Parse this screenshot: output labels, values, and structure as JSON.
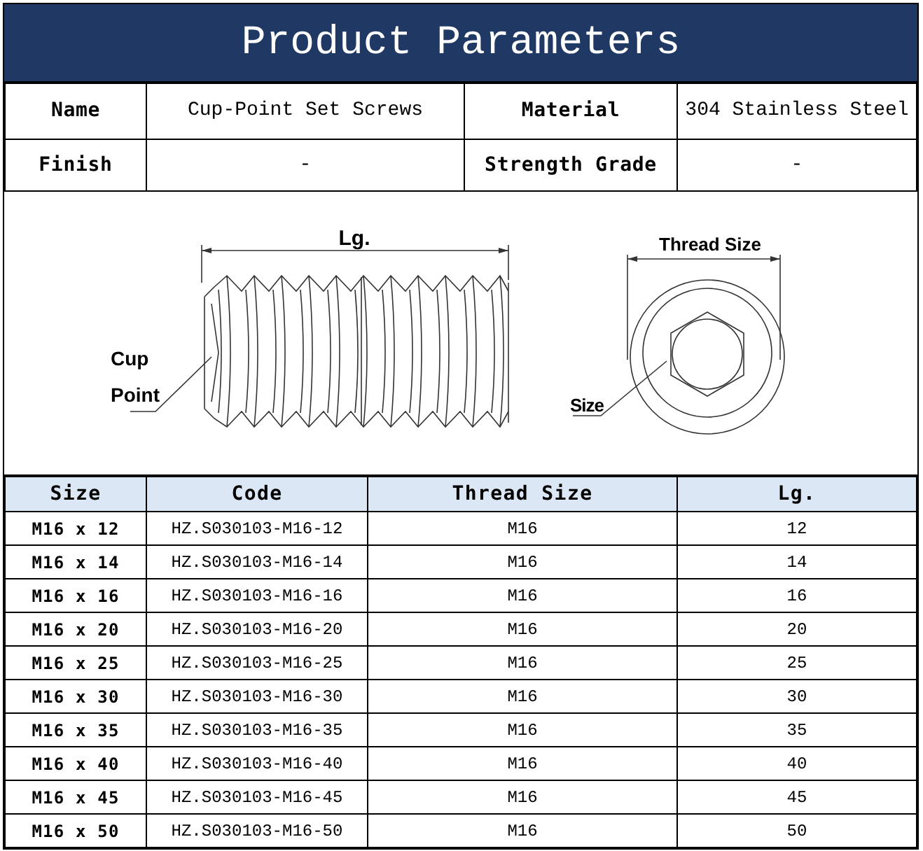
{
  "title": "Product Parameters",
  "specs": [
    {
      "label": "Name",
      "value": "Cup-Point Set Screws"
    },
    {
      "label": "Material",
      "value": "304 Stainless Steel"
    },
    {
      "label": "Finish",
      "value": "-"
    },
    {
      "label": "Strength Grade",
      "value": "-"
    }
  ],
  "drawing": {
    "length_label": "Lg.",
    "point_label": [
      "Cup",
      "Point"
    ],
    "thread_size_label": "Thread Size",
    "size_label": "Size"
  },
  "table": {
    "columns": [
      "Size",
      "Code",
      "Thread Size",
      "Lg."
    ],
    "rows": [
      [
        "M16 x 12",
        "HZ.S030103-M16-12",
        "M16",
        "12"
      ],
      [
        "M16 x 14",
        "HZ.S030103-M16-14",
        "M16",
        "14"
      ],
      [
        "M16 x 16",
        "HZ.S030103-M16-16",
        "M16",
        "16"
      ],
      [
        "M16 x 20",
        "HZ.S030103-M16-20",
        "M16",
        "20"
      ],
      [
        "M16 x 25",
        "HZ.S030103-M16-25",
        "M16",
        "25"
      ],
      [
        "M16 x 30",
        "HZ.S030103-M16-30",
        "M16",
        "30"
      ],
      [
        "M16 x 35",
        "HZ.S030103-M16-35",
        "M16",
        "35"
      ],
      [
        "M16 x 40",
        "HZ.S030103-M16-40",
        "M16",
        "40"
      ],
      [
        "M16 x 45",
        "HZ.S030103-M16-45",
        "M16",
        "45"
      ],
      [
        "M16 x 50",
        "HZ.S030103-M16-50",
        "M16",
        "50"
      ]
    ]
  }
}
